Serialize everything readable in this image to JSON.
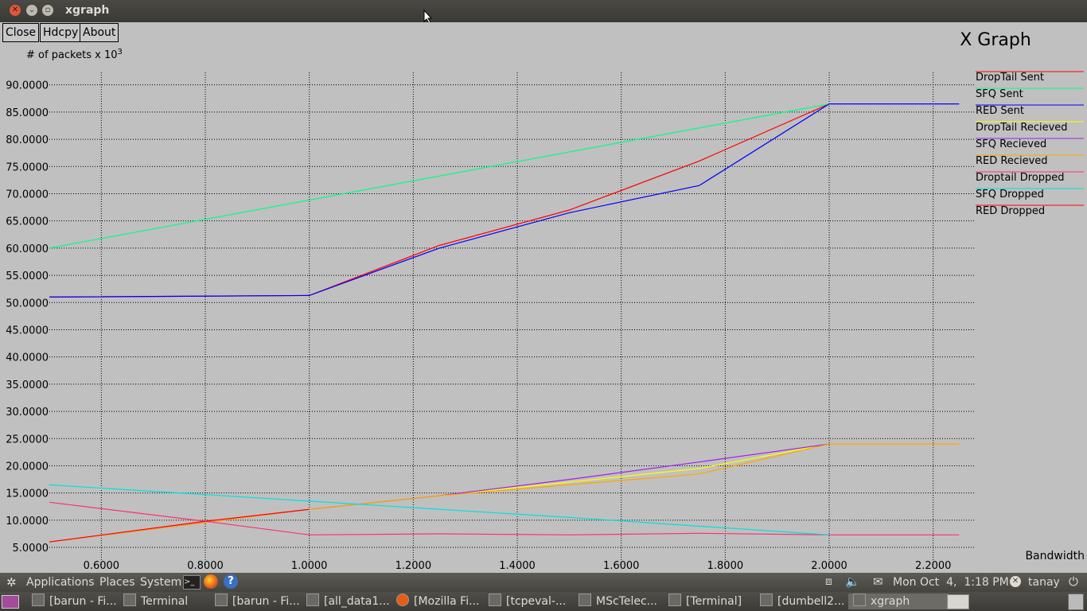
{
  "window": {
    "title": "xgraph",
    "buttons": [
      "Close",
      "Hdcpy",
      "About"
    ]
  },
  "chart_data": {
    "type": "line",
    "title": "X Graph",
    "ylabel": "# of packets x 10",
    "ylabel_exp": "3",
    "xlabel": "Bandwidth",
    "xlim": [
      0.5,
      2.28
    ],
    "ylim": [
      1.5,
      92
    ],
    "x_ticks": [
      "0.6000",
      "0.8000",
      "1.0000",
      "1.2000",
      "1.4000",
      "1.6000",
      "1.8000",
      "2.0000",
      "2.2000"
    ],
    "y_ticks": [
      "5.0000",
      "10.0000",
      "15.0000",
      "20.0000",
      "25.0000",
      "30.0000",
      "35.0000",
      "40.0000",
      "45.0000",
      "50.0000",
      "55.0000",
      "60.0000",
      "65.0000",
      "70.0000",
      "75.0000",
      "80.0000",
      "85.0000",
      "90.0000"
    ],
    "grid": true,
    "legend_position": "right",
    "series": [
      {
        "name": "DropTail Sent",
        "color": "#ff0000",
        "points": [
          [
            0.5,
            51.0
          ],
          [
            1.0,
            51.3
          ],
          [
            1.25,
            60.5
          ],
          [
            1.5,
            67.0
          ],
          [
            1.75,
            76.0
          ],
          [
            2.0,
            86.5
          ]
        ]
      },
      {
        "name": "SFQ Sent",
        "color": "#00ff80",
        "points": [
          [
            0.5,
            60.0
          ],
          [
            2.0,
            86.5
          ]
        ]
      },
      {
        "name": "RED Sent",
        "color": "#0000ff",
        "points": [
          [
            0.5,
            51.0
          ],
          [
            1.0,
            51.3
          ],
          [
            1.25,
            60.0
          ],
          [
            1.5,
            66.5
          ],
          [
            1.75,
            71.5
          ],
          [
            2.0,
            86.5
          ],
          [
            2.25,
            86.5
          ]
        ]
      },
      {
        "name": "DropTail Recieved",
        "color": "#ffff00",
        "points": [
          [
            0.5,
            6.0
          ],
          [
            1.0,
            12.0
          ],
          [
            1.25,
            14.5
          ],
          [
            1.5,
            17.0
          ],
          [
            1.75,
            19.5
          ],
          [
            2.0,
            24.0
          ]
        ]
      },
      {
        "name": "SFQ Recieved",
        "color": "#a020f0",
        "points": [
          [
            0.5,
            6.0
          ],
          [
            1.0,
            12.0
          ],
          [
            1.25,
            14.5
          ],
          [
            1.5,
            17.5
          ],
          [
            1.75,
            20.7
          ],
          [
            2.0,
            24.0
          ]
        ]
      },
      {
        "name": "RED Recieved",
        "color": "#ffa500",
        "points": [
          [
            0.5,
            6.0
          ],
          [
            1.0,
            12.0
          ],
          [
            1.25,
            14.5
          ],
          [
            1.5,
            16.5
          ],
          [
            1.75,
            18.5
          ],
          [
            2.0,
            24.0
          ],
          [
            2.25,
            24.0
          ]
        ]
      },
      {
        "name": "Droptail Dropped",
        "color": "#ff3070",
        "points": [
          [
            0.5,
            13.3
          ],
          [
            0.8,
            9.8
          ],
          [
            1.0,
            7.3
          ],
          [
            1.25,
            7.5
          ],
          [
            1.5,
            7.3
          ],
          [
            1.75,
            7.6
          ],
          [
            2.0,
            7.3
          ],
          [
            2.25,
            7.3
          ]
        ]
      },
      {
        "name": "SFQ Dropped",
        "color": "#00e0e0",
        "points": [
          [
            0.5,
            16.5
          ],
          [
            1.0,
            13.5
          ],
          [
            1.5,
            10.5
          ],
          [
            2.0,
            7.3
          ]
        ]
      },
      {
        "name": "RED Dropped",
        "color": "#ff0000",
        "points": [
          [
            0.5,
            6.0
          ],
          [
            0.8,
            9.8
          ],
          [
            1.0,
            12.0
          ]
        ]
      }
    ]
  },
  "topbar": {
    "menus": [
      "Applications",
      "Places",
      "System"
    ],
    "datetime": "Mon Oct  4,  1:18 PM",
    "user": "tanay"
  },
  "taskbar": {
    "items": [
      "[barun - Fi...",
      "Terminal",
      "[barun - Fi...",
      "[all_data1...",
      "[Mozilla Fi...",
      "[tcpeval-...",
      "MScTelec...",
      "[Terminal]",
      "[dumbell2...",
      "xgraph"
    ]
  }
}
